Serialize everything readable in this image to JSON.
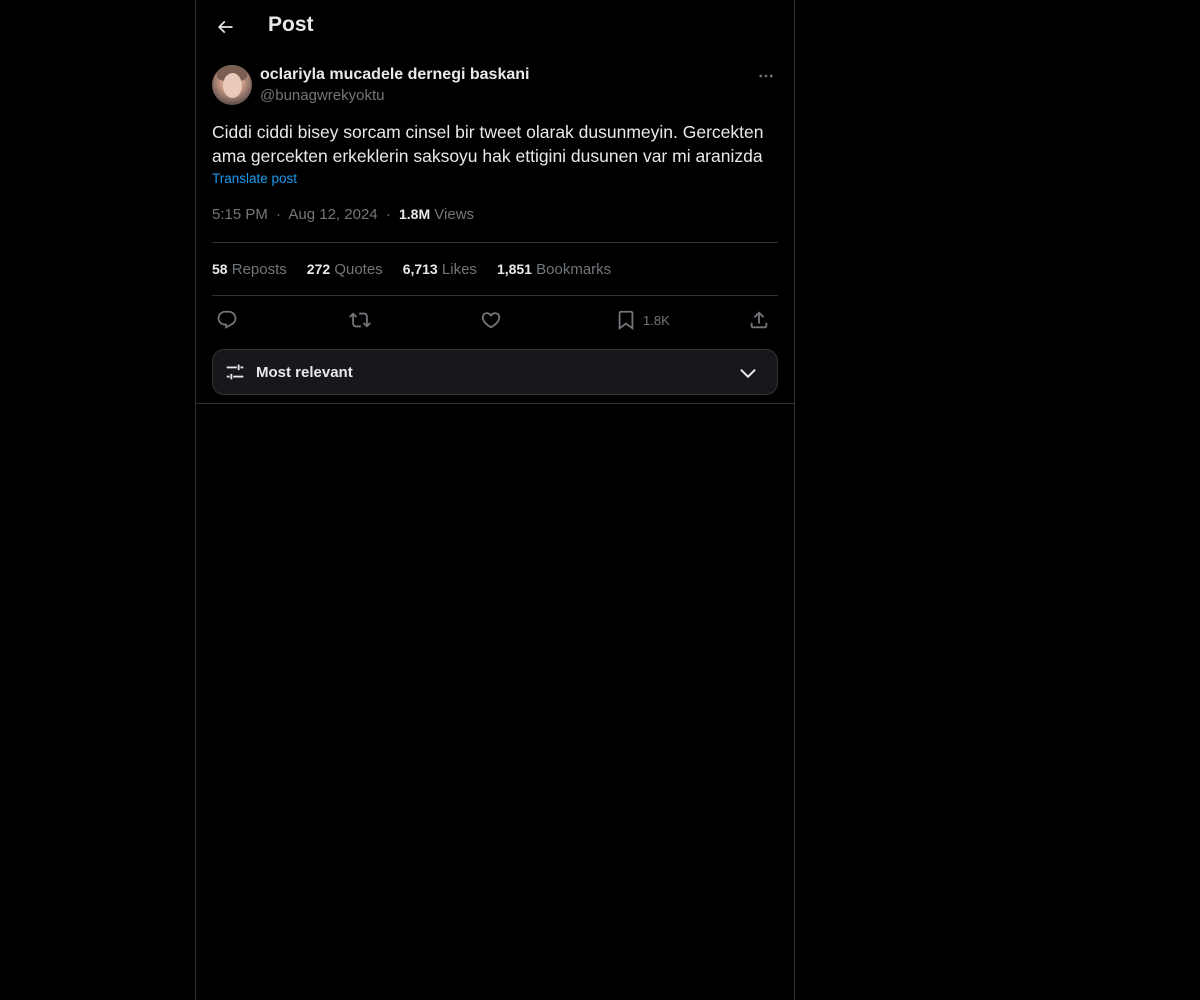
{
  "header": {
    "title": "Post",
    "back_icon": "arrow-left-icon"
  },
  "post": {
    "author": {
      "name": "oclariyla mucadele dernegi baskani",
      "handle": "@bunagwrekyoktu"
    },
    "text": "Ciddi ciddi bisey sorcam cinsel bir tweet olarak dusunmeyin. Gercekten ama gercekten erkeklerin saksoyu hak ettigini dusunen var mi aranizda",
    "translate_label": "Translate post",
    "time": "5:15 PM",
    "date": "Aug 12, 2024",
    "views_count": "1.8M",
    "views_label": "Views",
    "separator": "·"
  },
  "stats": {
    "reposts_count": "58",
    "reposts_label": "Reposts",
    "quotes_count": "272",
    "quotes_label": "Quotes",
    "likes_count": "6,713",
    "likes_label": "Likes",
    "bookmarks_count": "1,851",
    "bookmarks_label": "Bookmarks"
  },
  "actions": {
    "reply_icon": "reply-icon",
    "repost_icon": "repost-icon",
    "like_icon": "heart-icon",
    "bookmark_icon": "bookmark-icon",
    "bookmark_count": "1.8K",
    "share_icon": "share-icon"
  },
  "sort": {
    "label": "Most relevant",
    "icon": "sliders-icon",
    "chevron": "chevron-down-icon"
  },
  "colors": {
    "background": "#000000",
    "text_primary": "#e7e9ea",
    "text_secondary": "#71767b",
    "link": "#1d9bf0",
    "border": "#2f3336",
    "sort_bg": "#16181c"
  }
}
